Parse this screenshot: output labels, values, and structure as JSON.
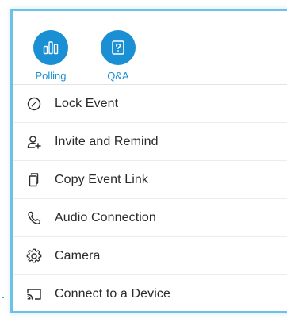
{
  "top_actions": [
    {
      "label": "Polling",
      "icon": "polling-icon"
    },
    {
      "label": "Q&A",
      "icon": "qa-icon"
    }
  ],
  "menu": {
    "items": [
      {
        "label": "Lock Event",
        "icon": "lock-event-icon"
      },
      {
        "label": "Invite and Remind",
        "icon": "invite-user-icon"
      },
      {
        "label": "Copy Event Link",
        "icon": "copy-icon"
      },
      {
        "label": "Audio Connection",
        "icon": "phone-icon"
      },
      {
        "label": "Camera",
        "icon": "gear-icon"
      },
      {
        "label": "Connect to a Device",
        "icon": "cast-icon"
      }
    ]
  },
  "colors": {
    "accent": "#1a8fd3",
    "panel_border": "#6cc1e6",
    "text": "#2a2a2a"
  }
}
